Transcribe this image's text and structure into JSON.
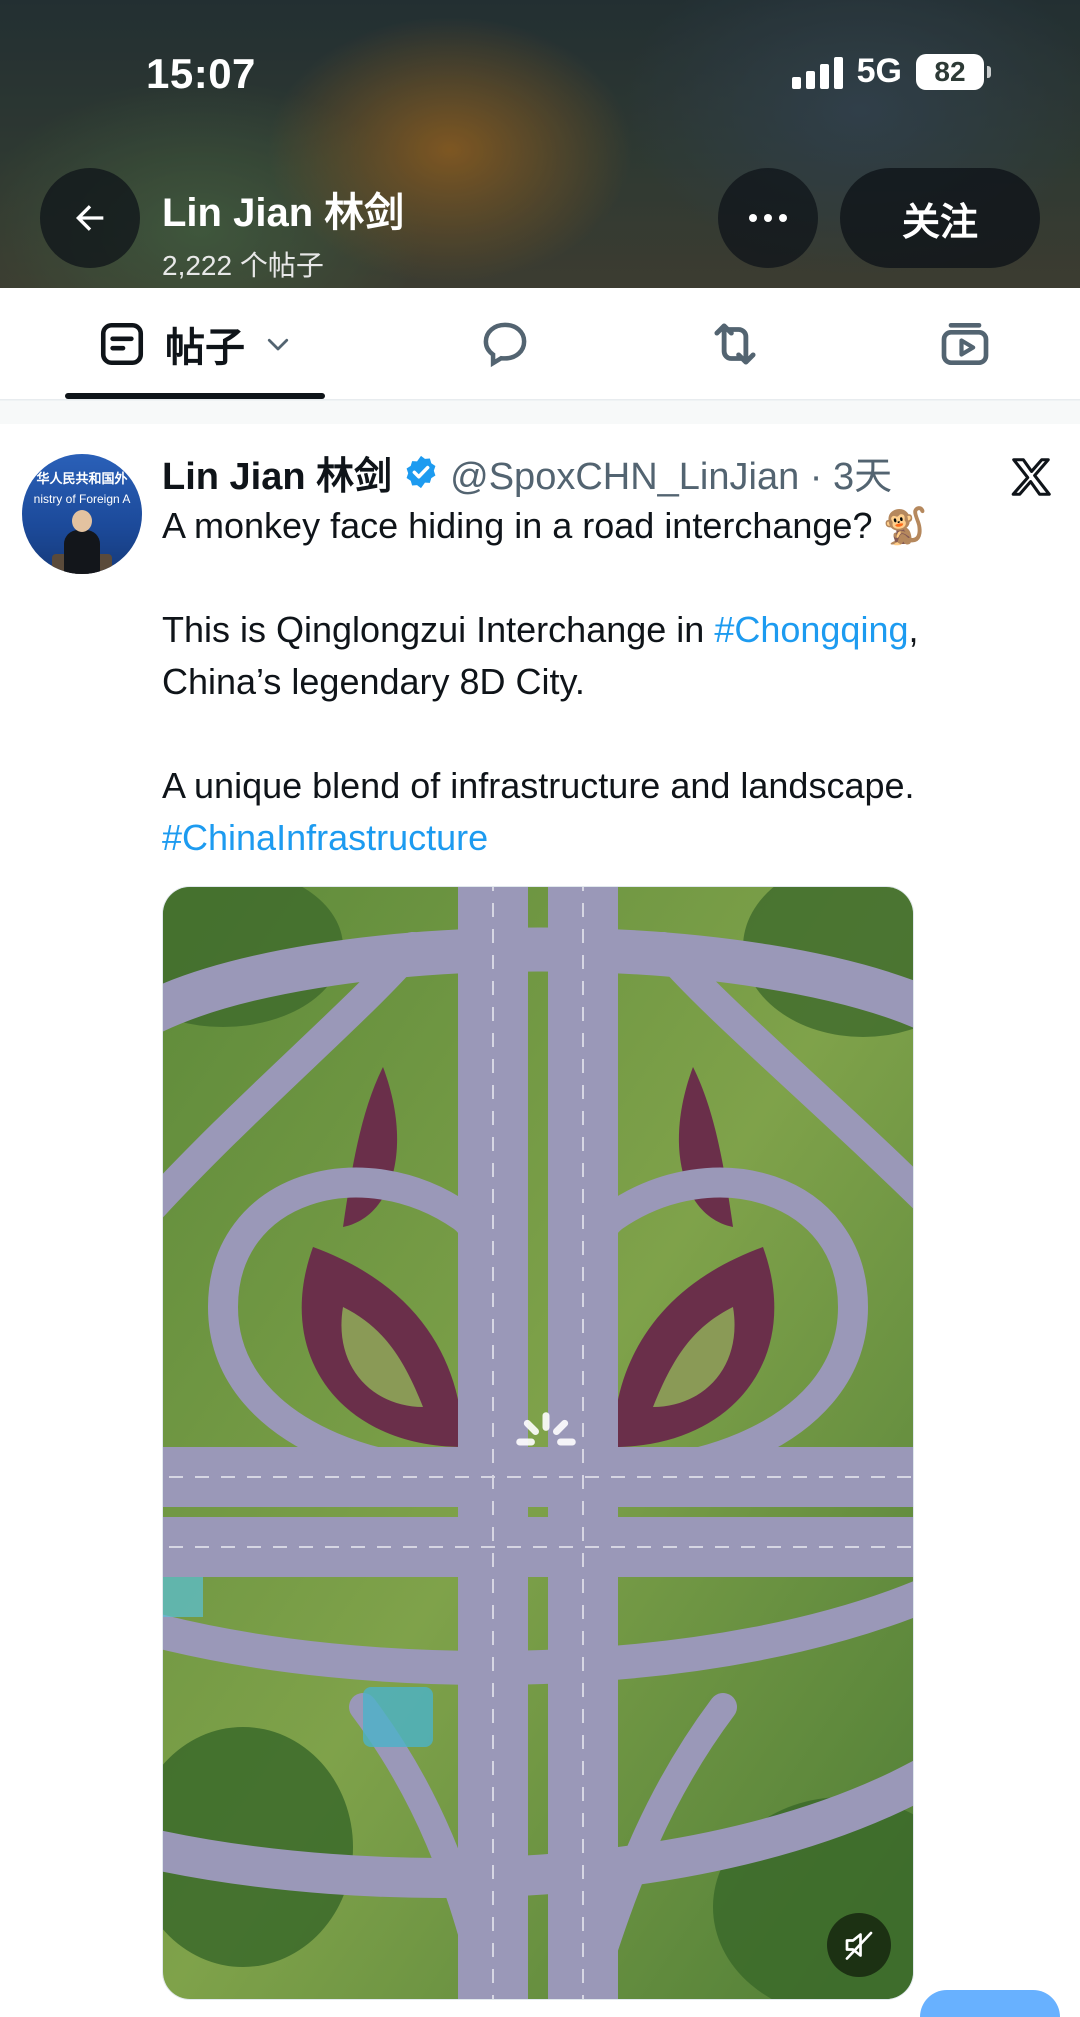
{
  "status_bar": {
    "time": "15:07",
    "network": "5G",
    "battery": "82"
  },
  "header": {
    "name": "Lin Jian 林剑",
    "post_count": "2,222 个帖子",
    "follow_label": "关注"
  },
  "tabs": {
    "posts_label": "帖子"
  },
  "post": {
    "author_name": "Lin Jian 林剑",
    "handle_time": "@SpoxCHN_LinJian · 3天",
    "avatar_text": "华人民共和国外",
    "avatar_text2": "nistry of Foreign A",
    "line1": "A monkey face hiding in a road interchange? 🐒",
    "line2_prefix": "This is Qinglongzui Interchange in ",
    "hashtag1": "#Chongqing",
    "line2_suffix": ",",
    "line3": "China’s legendary 8D City.",
    "line4": "A unique blend of infrastructure and landscape.",
    "hashtag2": "#ChinaInfrastructure"
  },
  "colors": {
    "link": "#1d9bf0",
    "verified": "#1d9bf0",
    "text": "#0f1419",
    "muted": "#536471"
  }
}
